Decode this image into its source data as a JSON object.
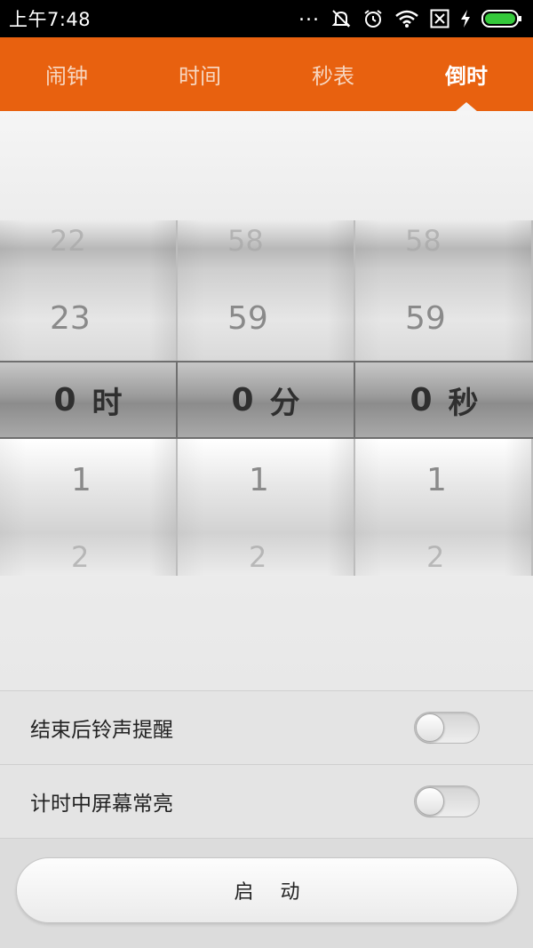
{
  "status_bar": {
    "time": "上午7:48",
    "overflow": "...",
    "icons": [
      "silent-icon",
      "alarm-clock-icon",
      "wifi-icon",
      "no-sim-icon",
      "charging-icon",
      "battery-icon"
    ]
  },
  "tabs": [
    {
      "label": "闹钟",
      "active": false
    },
    {
      "label": "时间",
      "active": false
    },
    {
      "label": "秒表",
      "active": false
    },
    {
      "label": "倒时",
      "active": true
    }
  ],
  "picker": {
    "hours": {
      "far_prev": "22",
      "prev": "23",
      "selected": "0",
      "unit": "时",
      "next": "1",
      "far_next": "2"
    },
    "minutes": {
      "far_prev": "58",
      "prev": "59",
      "selected": "0",
      "unit": "分",
      "next": "1",
      "far_next": "2"
    },
    "seconds": {
      "far_prev": "58",
      "prev": "59",
      "selected": "0",
      "unit": "秒",
      "next": "1",
      "far_next": "2"
    }
  },
  "settings": [
    {
      "label": "结束后铃声提醒",
      "enabled": false
    },
    {
      "label": "计时中屏幕常亮",
      "enabled": false
    }
  ],
  "start_button": {
    "label": "启动"
  },
  "colors": {
    "accent": "#e8610f",
    "background": "#ececec"
  }
}
